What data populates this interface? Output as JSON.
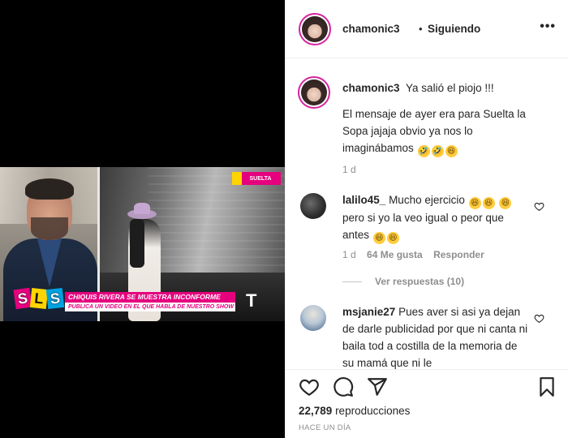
{
  "post": {
    "username": "chamonic3",
    "separator": "•",
    "follow_label": "Siguiendo",
    "more_label": "•••"
  },
  "video": {
    "lower_third_title": "CHIQUIS RIVERA SE MUESTRA INCONFORME",
    "lower_third_subtitle": "PUBLICA UN VIDEO EN EL QUE HABLA DE NUESTRO SHOW",
    "logo_letters": [
      "S",
      "L",
      "S"
    ],
    "corner_tag": "SUELTA",
    "network_logo": "T"
  },
  "caption": {
    "username": "chamonic3",
    "line1": "Ya salió el piojo !!!",
    "line2": "El mensaje de ayer era para Suelta la Sopa jajaja obvio ya nos lo imaginábamos",
    "emoji": [
      "🤣",
      "🤣",
      "😆"
    ],
    "age": "1 d"
  },
  "comments": [
    {
      "username": "lalilo45_",
      "text_a": "Mucho ejercicio",
      "text_b": "pero si yo la veo igual o peor que antes",
      "age": "1 d",
      "likes": "64 Me gusta",
      "reply_label": "Responder",
      "view_replies": "Ver respuestas (10)"
    },
    {
      "username": "msjanie27",
      "text": "Pues aver si asi ya dejan de darle publicidad por que ni canta ni baila tod a costilla de la memoria de su mamá que ni le"
    }
  ],
  "actions": {
    "like_icon": "heart-icon",
    "comment_icon": "comment-icon",
    "share_icon": "share-icon",
    "save_icon": "bookmark-icon"
  },
  "stats": {
    "views_count": "22,789",
    "views_label": "reproducciones",
    "time_ago": "HACE UN DÍA"
  },
  "colors": {
    "brand_pink": "#e5007e",
    "story_ring": "#d6249f",
    "muted_text": "#8e8e8e"
  }
}
